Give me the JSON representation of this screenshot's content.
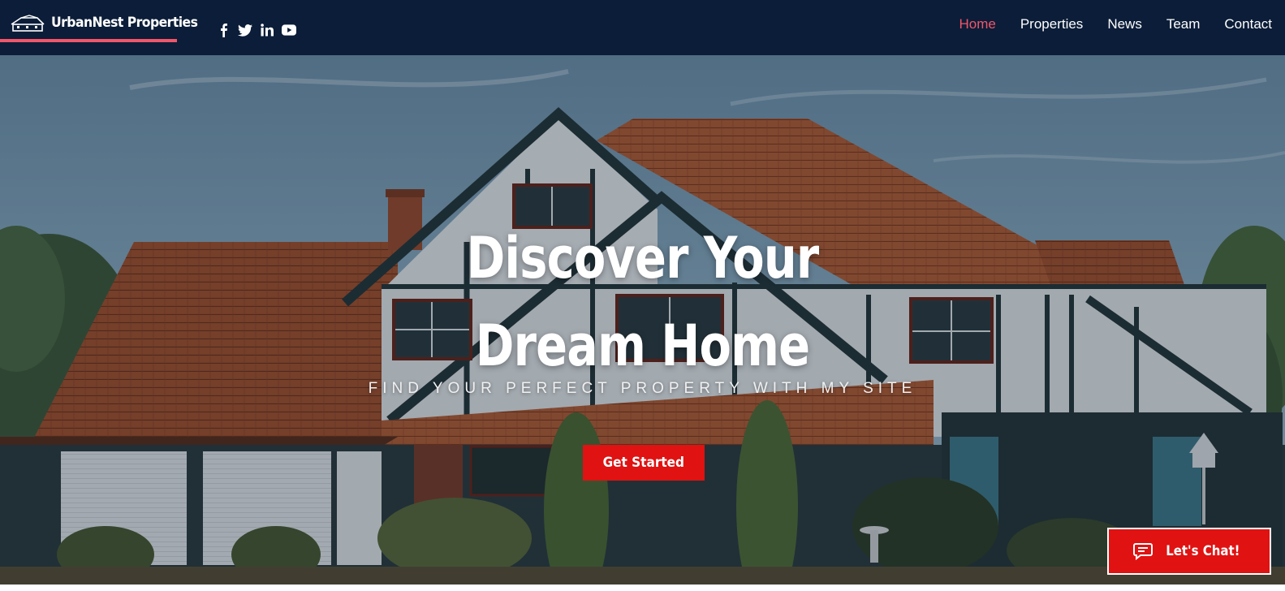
{
  "brand": {
    "name": "UrbanNest Properties",
    "accent_color": "#f1566a",
    "header_bg": "#0b1d38"
  },
  "social": [
    {
      "icon": "facebook-icon"
    },
    {
      "icon": "twitter-icon"
    },
    {
      "icon": "linkedin-icon"
    },
    {
      "icon": "youtube-icon"
    }
  ],
  "nav": {
    "items": [
      {
        "label": "Home",
        "active": true
      },
      {
        "label": "Properties",
        "active": false
      },
      {
        "label": "News",
        "active": false
      },
      {
        "label": "Team",
        "active": false
      },
      {
        "label": "Contact",
        "active": false
      }
    ]
  },
  "hero": {
    "title_line1": "Discover Your",
    "title_line2": "Dream Home",
    "subtitle": "FIND YOUR PERFECT PROPERTY WITH MY SITE",
    "cta_label": "Get Started",
    "cta_color": "#e01212"
  },
  "chat": {
    "label": "Let's Chat!",
    "icon": "chat-bubble-icon"
  }
}
